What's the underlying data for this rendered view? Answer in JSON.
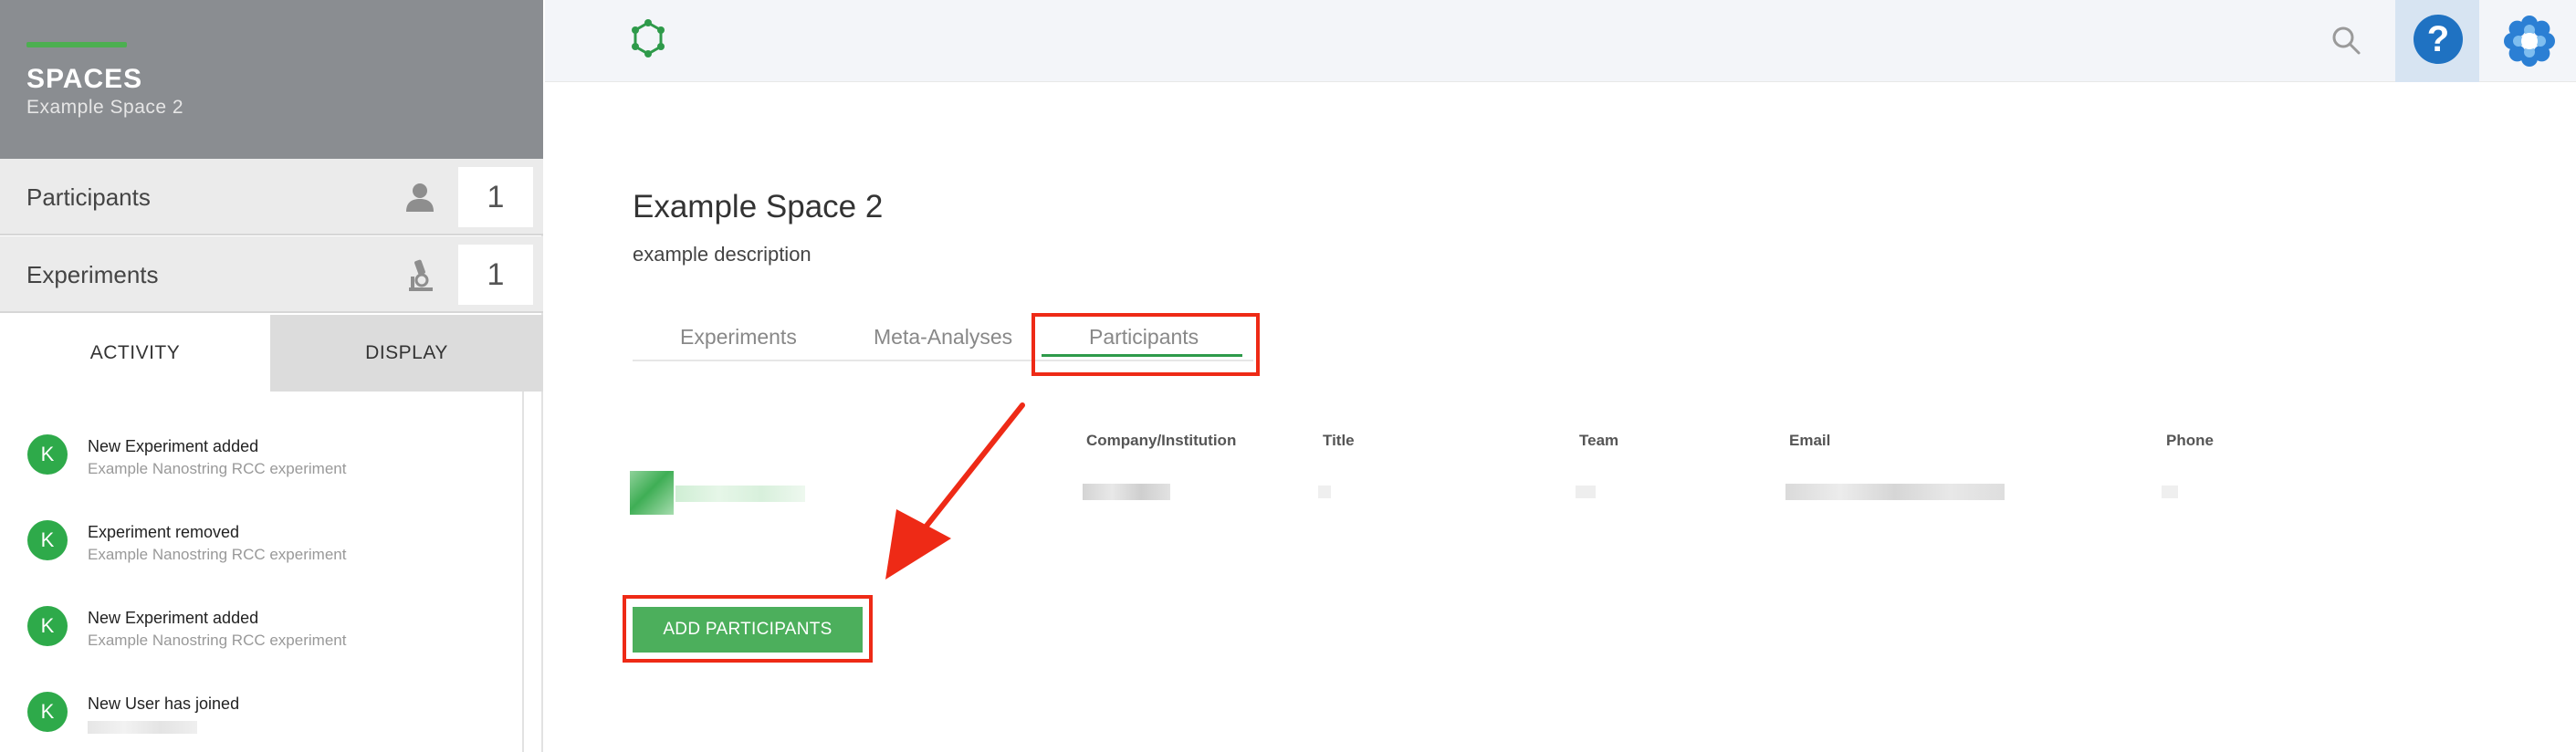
{
  "sidebar": {
    "title": "SPACES",
    "subtitle": "Example Space 2",
    "rows": [
      {
        "label": "Participants",
        "icon": "person-icon",
        "count": "1"
      },
      {
        "label": "Experiments",
        "icon": "microscope-icon",
        "count": "1"
      }
    ],
    "tabs": [
      "ACTIVITY",
      "DISPLAY"
    ],
    "feed": [
      {
        "avatar": "K",
        "title": "New Experiment added",
        "subtitle": "Example Nanostring RCC experiment"
      },
      {
        "avatar": "K",
        "title": "Experiment removed",
        "subtitle": "Example Nanostring RCC experiment"
      },
      {
        "avatar": "K",
        "title": "New Experiment added",
        "subtitle": "Example Nanostring RCC experiment"
      },
      {
        "avatar": "K",
        "title": "New User has joined",
        "subtitle": ""
      }
    ]
  },
  "topbar": {
    "logo_icon": "network-logo-icon",
    "search_icon": "search-icon",
    "help_label": "?",
    "profile_icon": "profile-flower-icon"
  },
  "main": {
    "title": "Example Space 2",
    "description": "example description",
    "tabs": [
      {
        "label": "Experiments",
        "active": false
      },
      {
        "label": "Meta-Analyses",
        "active": false
      },
      {
        "label": "Participants",
        "active": true
      }
    ],
    "table_headers": [
      "Company/Institution",
      "Title",
      "Team",
      "Email",
      "Phone"
    ],
    "add_button": "ADD PARTICIPANTS"
  },
  "colors": {
    "accent_green": "#4caf50",
    "highlight_red": "#ee2a16",
    "help_blue": "#1f72c2",
    "sidebar_header": "#8a8d91"
  }
}
